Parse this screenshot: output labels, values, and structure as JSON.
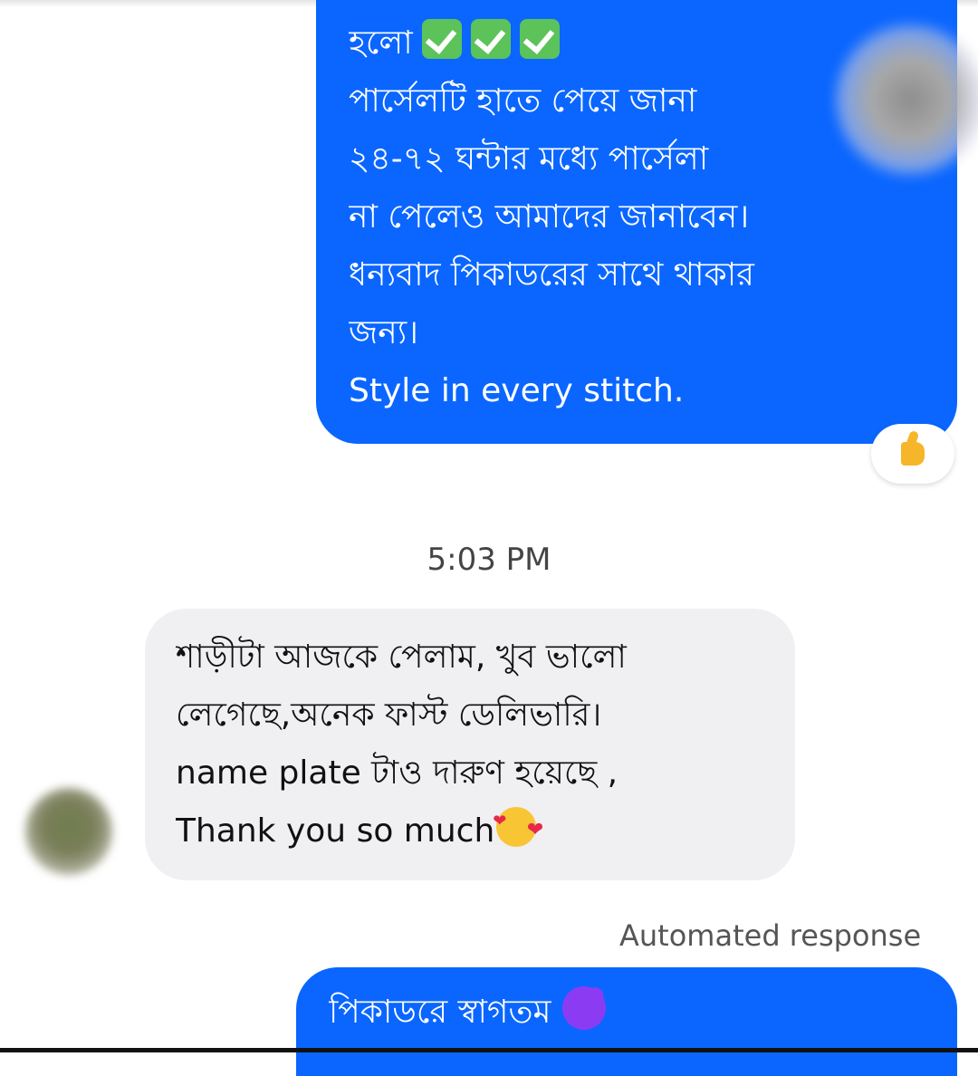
{
  "conversation": {
    "outgoing_1": {
      "lines": [
        "হলো",
        "পার্সেলটি হাতে পেয়ে জানা",
        "২৪-৭২ ঘন্টার মধ্যে পার্সেলা",
        "না পেলেও আমাদের জানাবেন।",
        "ধন্যবাদ পিকাডরের সাথে থাকার",
        "জন্য।",
        "Style in every stitch."
      ],
      "check_count": 3,
      "reaction": "thumbs-up"
    },
    "timestamp": "5:03 PM",
    "incoming_1": {
      "lines": [
        "শাড়ীটা আজকে পেলাম, খুব ভালো",
        "লেগেছে,অনেক ফাস্ট ডেলিভারি।",
        "name plate  টাও দারুণ হয়েছে ,",
        "Thank you so much"
      ],
      "emoji": "smiling-face-with-hearts"
    },
    "automated_label": "Automated response",
    "outgoing_2": {
      "text": "পিকাডরে স্বাগতম",
      "emoji": "purple-heart"
    }
  },
  "colors": {
    "outgoing_bubble": "#0a66ff",
    "incoming_bubble": "#f0f0f3",
    "check_green": "#5cc35a",
    "purple_heart": "#8b3cf2"
  }
}
